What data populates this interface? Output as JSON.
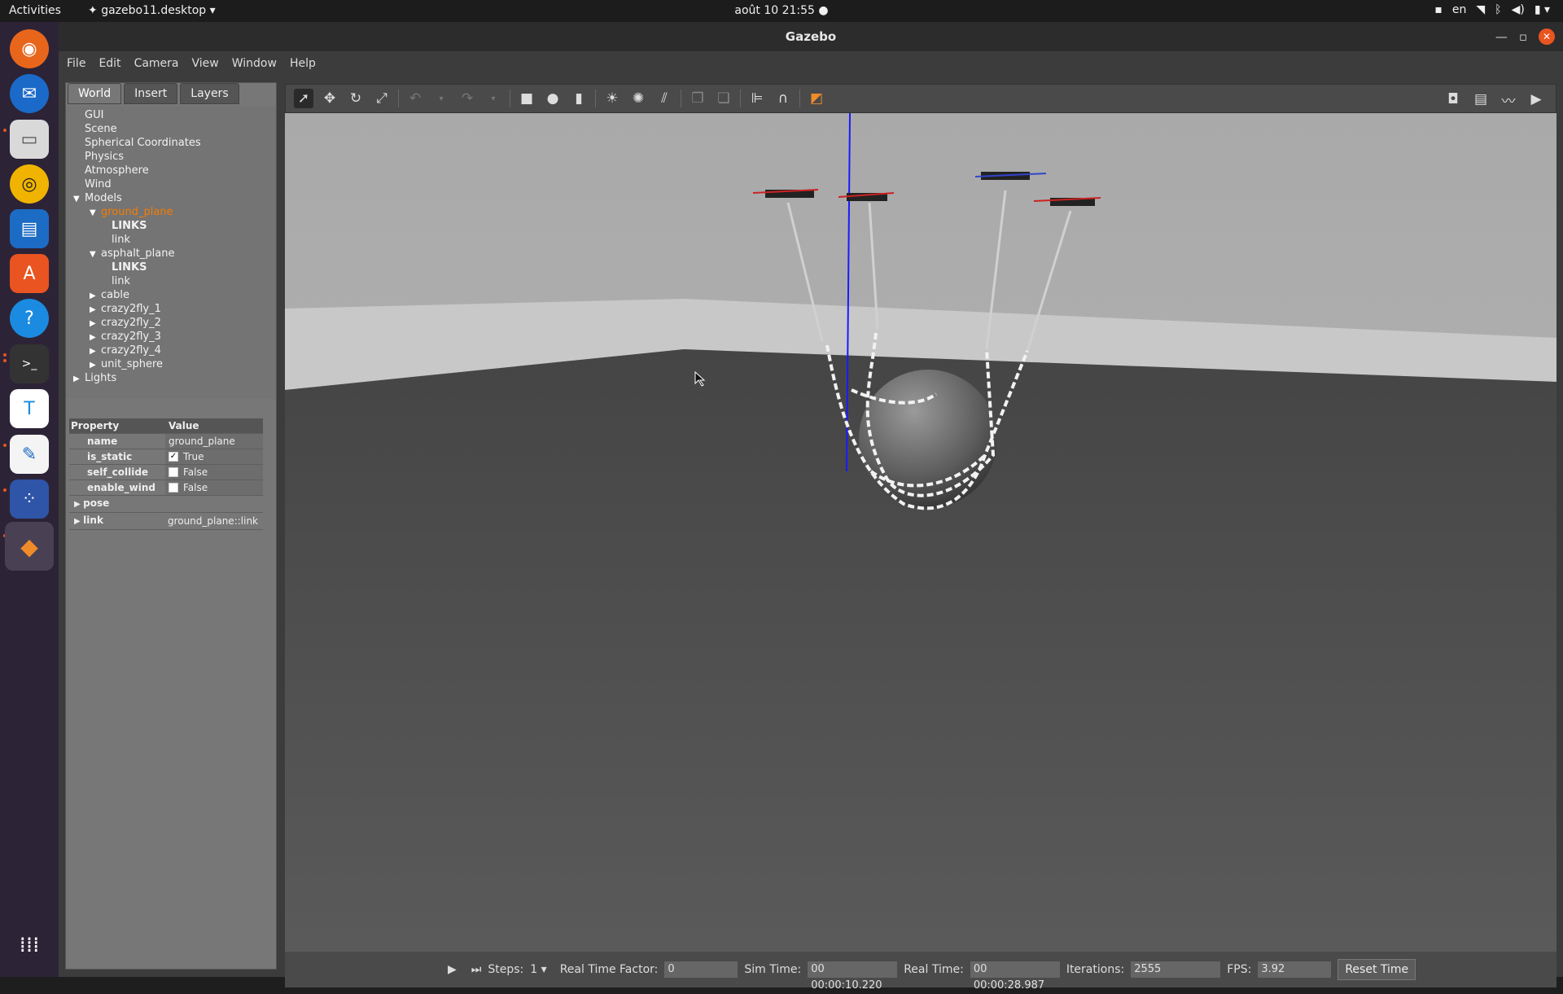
{
  "topbar": {
    "activities": "Activities",
    "app_name": "gazebo11.desktop",
    "clock": "août 10  21:55",
    "lang": "en"
  },
  "window": {
    "title": "Gazebo"
  },
  "menubar": {
    "items": [
      "File",
      "Edit",
      "Camera",
      "View",
      "Window",
      "Help"
    ]
  },
  "panel": {
    "tabs": [
      "World",
      "Insert",
      "Layers"
    ],
    "tree": {
      "gui": "GUI",
      "scene": "Scene",
      "spherical": "Spherical Coordinates",
      "physics": "Physics",
      "atmosphere": "Atmosphere",
      "wind": "Wind",
      "models": "Models",
      "ground_plane": "ground_plane",
      "links1": "LINKS",
      "link1": "link",
      "asphalt_plane": "asphalt_plane",
      "links2": "LINKS",
      "link2": "link",
      "cable": "cable",
      "cf1": "crazy2fly_1",
      "cf2": "crazy2fly_2",
      "cf3": "crazy2fly_3",
      "cf4": "crazy2fly_4",
      "unit_sphere": "unit_sphere",
      "lights": "Lights"
    },
    "props": {
      "h_property": "Property",
      "h_value": "Value",
      "name_k": "name",
      "name_v": "ground_plane",
      "static_k": "is_static",
      "static_v": "True",
      "selfc_k": "self_collide",
      "selfc_v": "False",
      "wind_k": "enable_wind",
      "wind_v": "False",
      "pose_k": "pose",
      "link_k": "link",
      "link_v": "ground_plane::link"
    }
  },
  "bottom": {
    "steps_label": "Steps:",
    "steps_value": "1",
    "rtf_label": "Real Time Factor:",
    "rtf_value": "0",
    "sim_label": "Sim Time:",
    "sim_value": "00 00:00:10.220",
    "real_label": "Real Time:",
    "real_value": "00 00:00:28.987",
    "iter_label": "Iterations:",
    "iter_value": "2555",
    "fps_label": "FPS:",
    "fps_value": "3.92",
    "reset_label": "Reset Time"
  },
  "colors": {
    "accent": "#e95420",
    "selected_item": "#f57c00"
  }
}
